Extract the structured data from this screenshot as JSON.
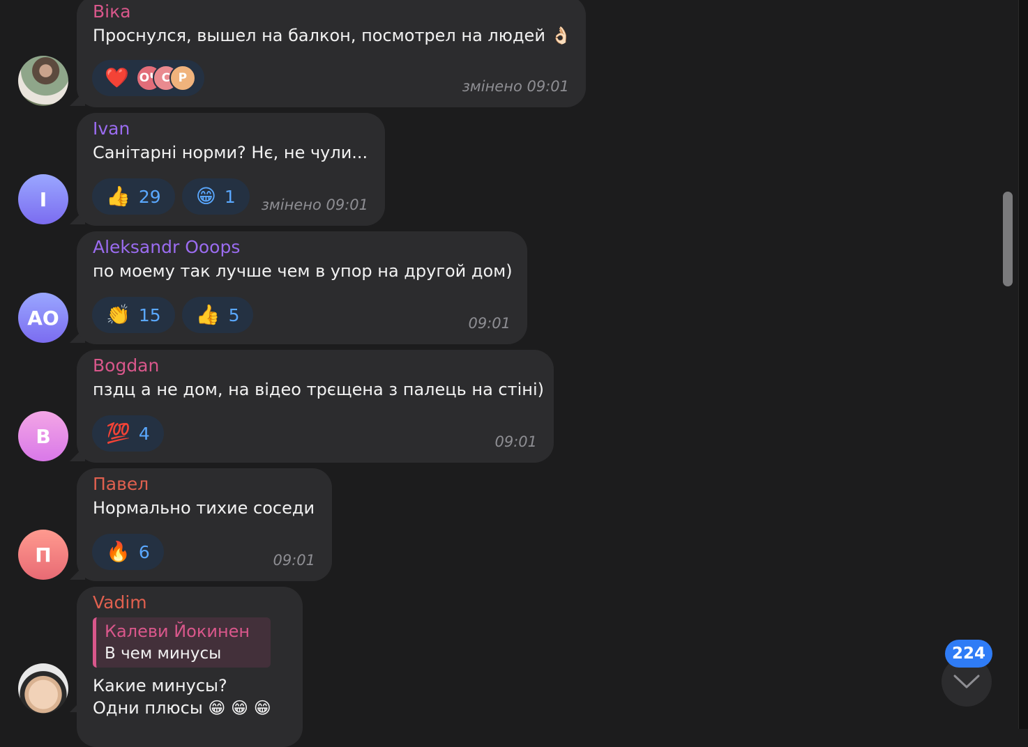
{
  "messages": [
    {
      "sender": "Віка",
      "text": "Проснулся, вышел на балкон, посмотрел на людей 👌🏻",
      "time": "змінено 09:01",
      "reaction_emoji": "❤️",
      "reactors": [
        "ОЧ",
        "С",
        "Р"
      ]
    },
    {
      "sender": "Ivan",
      "avatar": "I",
      "text": "Санітарні норми? Нє, не чули...",
      "time": "змінено 09:01",
      "reactions": [
        {
          "emoji": "👍",
          "count": "29"
        },
        {
          "emoji": "😁",
          "count": "1"
        }
      ]
    },
    {
      "sender": "Aleksandr Ooops",
      "avatar": "AO",
      "text": "по моему так лучше чем в упор на другой дом)",
      "time": "09:01",
      "reactions": [
        {
          "emoji": "👏",
          "count": "15"
        },
        {
          "emoji": "👍",
          "count": "5"
        }
      ]
    },
    {
      "sender": "Bogdan",
      "avatar": "B",
      "text": "пздц а не дом, на відео трєщена з палець на стіні)",
      "time": "09:01",
      "reactions": [
        {
          "emoji": "💯",
          "count": "4"
        }
      ]
    },
    {
      "sender": "Павел",
      "avatar": "П",
      "text": "Нормально тихие соседи",
      "time": "09:01",
      "reactions": [
        {
          "emoji": "🔥",
          "count": "6"
        }
      ]
    },
    {
      "sender": "Vadim",
      "quote_author": "Калеви Йокинен",
      "quote_text": "В чем минусы",
      "text_line1": "Какие минусы?",
      "text_line2": "Одни плюсы 😁 😁 😁"
    }
  ],
  "unread_count": "224",
  "colors": {
    "vika": "#d9578b",
    "ivan": "#9b6cf0",
    "aleksandr": "#9b6cf0",
    "bogdan": "#d9578b",
    "pavel": "#e0604f",
    "vadim": "#e0604f",
    "reaction_bg": "#243142",
    "accent": "#2f7cf6"
  }
}
